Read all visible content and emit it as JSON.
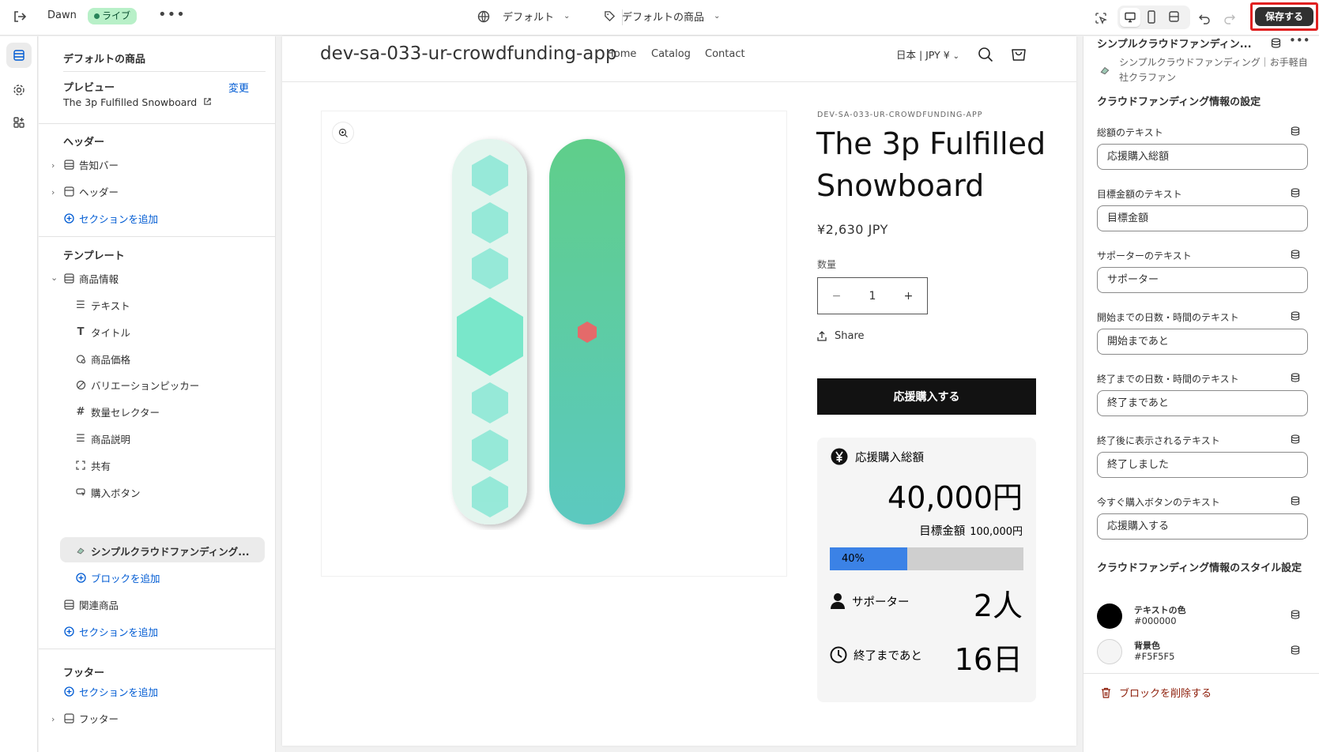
{
  "topbar": {
    "theme_name": "Dawn",
    "live_badge": "ライブ",
    "more": "•••",
    "context_dropdown": "デフォルト",
    "template_dropdown": "デフォルトの商品",
    "save_label": "保存する"
  },
  "left_panel": {
    "title": "デフォルトの商品",
    "preview_label": "プレビュー",
    "change_link": "変更",
    "preview_product": "The 3p Fulfilled Snowboard",
    "header_group": "ヘッダー",
    "header_items": [
      "告知バー",
      "ヘッダー"
    ],
    "add_section": "セクションを追加",
    "template_group": "テンプレート",
    "product_info": "商品情報",
    "blocks": [
      "テキスト",
      "タイトル",
      "商品価格",
      "バリエーションピッカー",
      "数量セレクター",
      "商品説明",
      "共有",
      "購入ボタン",
      "シンプルクラウドファンディング..."
    ],
    "add_block": "ブロックを追加",
    "related": "関連商品",
    "footer_group": "フッター",
    "footer_item": "フッター"
  },
  "store": {
    "logo": "dev-sa-033-ur-crowdfunding-app",
    "nav": [
      "Home",
      "Catalog",
      "Contact"
    ],
    "currency": "日本 | JPY ¥",
    "vendor": "DEV-SA-033-UR-CROWDFUNDING-APP",
    "product_title": "The 3p Fulfilled Snowboard",
    "price": "¥2,630 JPY",
    "qty_label": "数量",
    "qty_minus": "−",
    "qty_value": "1",
    "qty_plus": "+",
    "share": "Share",
    "buy_button": "応援購入する",
    "cf": {
      "total_label": "応援購入総額",
      "total_value": "40,000円",
      "goal_label": "目標金額",
      "goal_value": "100,000円",
      "progress_label": "40%",
      "progress": 0.4,
      "supporters_label": "サポーター",
      "supporters_value": "2人",
      "remaining_label": "終了まであと",
      "remaining_value": "16日"
    }
  },
  "right_panel": {
    "block_title": "シンプルクラウドファンディン...",
    "block_subtitle": "シンプルクラウドファンディング｜お手軽自社クラファン",
    "section_settings": "クラウドファンディング情報の設定",
    "fields": [
      {
        "label": "総額のテキスト",
        "value": "応援購入総額"
      },
      {
        "label": "目標金額のテキスト",
        "value": "目標金額"
      },
      {
        "label": "サポーターのテキスト",
        "value": "サポーター"
      },
      {
        "label": "開始までの日数・時間のテキスト",
        "value": "開始まであと"
      },
      {
        "label": "終了までの日数・時間のテキスト",
        "value": "終了まであと"
      },
      {
        "label": "終了後に表示されるテキスト",
        "value": "終了しました"
      },
      {
        "label": "今すぐ購入ボタンのテキスト",
        "value": "応援購入する"
      }
    ],
    "section_style": "クラウドファンディング情報のスタイル設定",
    "colors": [
      {
        "label": "テキストの色",
        "value": "#000000"
      },
      {
        "label": "背景色",
        "value": "#F5F5F5"
      }
    ],
    "delete_block": "ブロックを削除する"
  },
  "colors": {
    "accent_link": "#005bd3",
    "progress_fill": "#3b82e6",
    "live_badge_bg": "#b8f0c8",
    "buy_button_bg": "#121212",
    "save_highlight": "#e02020"
  }
}
